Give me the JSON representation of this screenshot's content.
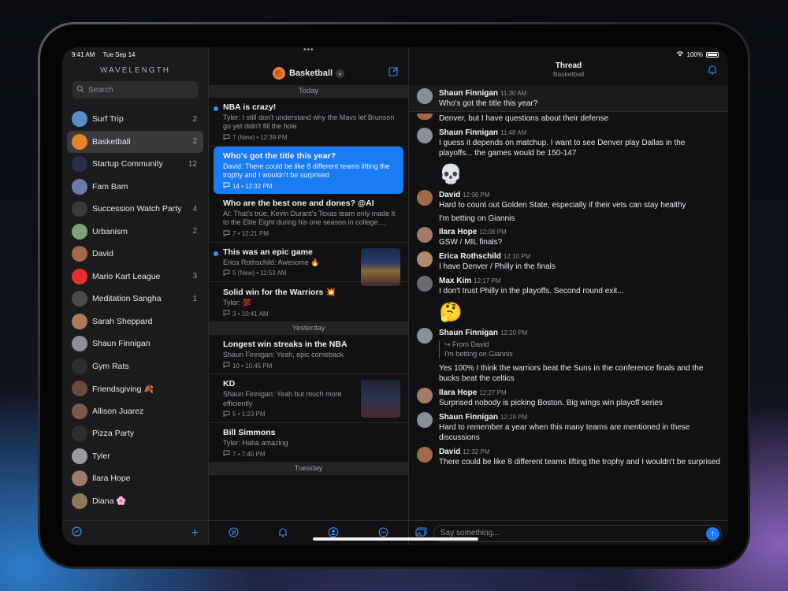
{
  "status": {
    "time": "9:41 AM",
    "date": "Tue Sep 14",
    "battery": "100%"
  },
  "sidebar": {
    "app_name": "WAVELENGTH",
    "search_placeholder": "Search",
    "rooms": [
      {
        "name": "Surf Trip",
        "count": "2",
        "color": "#5b8cc7",
        "emoji": ""
      },
      {
        "name": "Basketball",
        "count": "2",
        "color": "#e8822d",
        "emoji": "🏀"
      },
      {
        "name": "Startup Community",
        "count": "12",
        "color": "#2b2d4a",
        "emoji": "🚀"
      },
      {
        "name": "Fam Bam",
        "count": "",
        "color": "#6d7aa8",
        "emoji": ""
      },
      {
        "name": "Succession Watch Party",
        "count": "4",
        "color": "#3a3a3a",
        "emoji": ""
      },
      {
        "name": "Urbanism",
        "count": "2",
        "color": "#7ea07a",
        "emoji": ""
      },
      {
        "name": "David",
        "count": "",
        "color": "#a06a4a",
        "emoji": ""
      },
      {
        "name": "Mario Kart League",
        "count": "3",
        "color": "#e63030",
        "emoji": ""
      },
      {
        "name": "Meditation Sangha",
        "count": "1",
        "color": "#4a4a4a",
        "emoji": "🧘"
      },
      {
        "name": "Sarah Sheppard",
        "count": "",
        "color": "#b07a5a",
        "emoji": ""
      },
      {
        "name": "Shaun Finnigan",
        "count": "",
        "color": "#8a8e96",
        "emoji": ""
      },
      {
        "name": "Gym Rats",
        "count": "",
        "color": "#2e2e2e",
        "emoji": "🏋"
      },
      {
        "name": "Friendsgiving 🍂",
        "count": "",
        "color": "#6a4a3a",
        "emoji": ""
      },
      {
        "name": "Allison Juarez",
        "count": "",
        "color": "#7a5a4a",
        "emoji": ""
      },
      {
        "name": "Pizza Party",
        "count": "",
        "color": "#2e2e2e",
        "emoji": "🍕"
      },
      {
        "name": "Tyler",
        "count": "",
        "color": "#9a9aa2",
        "emoji": ""
      },
      {
        "name": "Ilara Hope",
        "count": "",
        "color": "#a07a6a",
        "emoji": ""
      },
      {
        "name": "Diana 🌸",
        "count": "",
        "color": "#8a7a5a",
        "emoji": ""
      }
    ]
  },
  "threads": {
    "room_name": "Basketball",
    "today_label": "Today",
    "yesterday_label": "Yesterday",
    "tuesday_label": "Tuesday",
    "today": [
      {
        "title": "NBA is crazy!",
        "preview": "Tyler: I still don't understand why the Mavs let Brunson go yet didn't fill the hole",
        "meta": "7 (New) • 12:39 PM",
        "unread": true
      },
      {
        "title": "Who's got the title this year?",
        "preview": "David: There could be like 8 different teams lifting the trophy and I wouldn't be surprised",
        "meta": "14 • 12:32 PM",
        "selected": true
      },
      {
        "title": "Who are the best one and dones? @AI",
        "preview": "AI: That's true, Kevin Durant's Texas team only made it to the Elite Eight during his one season in college....",
        "meta": "7 • 12:21 PM"
      },
      {
        "title": "This was an epic game",
        "preview": "Erica Rothschild: Awesome 🔥",
        "meta": "5 (New) • 11:53 AM",
        "unread": true,
        "thumb": true
      },
      {
        "title": "Solid win for the Warriors 💥",
        "preview": "Tyler: 💯",
        "meta": "3 • 10:41 AM"
      }
    ],
    "yesterday": [
      {
        "title": "Longest win streaks in the NBA",
        "preview": "Shaun Finnigan: Yeah, epic comeback",
        "meta": "10 • 10:45 PM"
      },
      {
        "title": "KD",
        "preview": "Shaun Finnigan: Yeah but much more efficiently",
        "meta": "5 • 1:23 PM",
        "thumb": true
      },
      {
        "title": "Bill Simmons",
        "preview": "Tyler: Haha amazing",
        "meta": "7 • 7:40 PM"
      }
    ]
  },
  "conversation": {
    "title": "Thread",
    "subtitle": "Basketball",
    "pinned": {
      "name": "Shaun Finnigan",
      "time": "11:30 AM",
      "text": "Who's got the title this year?"
    },
    "partial_text": "Denver, but I have questions about their defense",
    "messages": [
      {
        "name": "Shaun Finnigan",
        "time": "11:48 AM",
        "texts": [
          "I guess it depends on matchup. I want to see Denver play Dallas in the playoffs... the games would be 150-147"
        ],
        "emoji": "💀",
        "color": "#8a8e96"
      },
      {
        "name": "David",
        "time": "12:06 PM",
        "texts": [
          "Hard to count out Golden State, especially if their vets can stay healthy"
        ],
        "cont": "I'm betting on Giannis",
        "color": "#a06a4a"
      },
      {
        "name": "Ilara Hope",
        "time": "12:08 PM",
        "texts": [
          "GSW / MIL finals?"
        ],
        "color": "#a07a6a"
      },
      {
        "name": "Erica Rothschild",
        "time": "12:10 PM",
        "texts": [
          "I have Denver / Philly in the finals"
        ],
        "color": "#b08a6a"
      },
      {
        "name": "Max Kim",
        "time": "12:17 PM",
        "texts": [
          "I don't trust Philly in the playoffs. Second round exit..."
        ],
        "emoji": "🤔",
        "color": "#6a6a72"
      },
      {
        "name": "Shaun Finnigan",
        "time": "12:20 PM",
        "reply_from": "From David",
        "reply_text": "I'm betting on Giannis",
        "texts": [
          "Yes 100% I think the warriors beat the Suns in the conference finals and the bucks beat the celtics"
        ],
        "color": "#8a8e96"
      },
      {
        "name": "Ilara Hope",
        "time": "12:27 PM",
        "texts": [
          "Surprised nobody is picking Boston. Big wings win playoff series"
        ],
        "color": "#a07a6a"
      },
      {
        "name": "Shaun Finnigan",
        "time": "12:29 PM",
        "texts": [
          "Hard to remember a year when this many teams are mentioned in these discussions"
        ],
        "color": "#8a8e96"
      },
      {
        "name": "David",
        "time": "12:32 PM",
        "texts": [
          "There could be like 8 different teams lifting the trophy and I wouldn't be surprised"
        ],
        "color": "#a06a4a"
      }
    ],
    "composer_placeholder": "Say something..."
  },
  "colors": {
    "accent": "#1a7cf5",
    "background": "#111113"
  }
}
